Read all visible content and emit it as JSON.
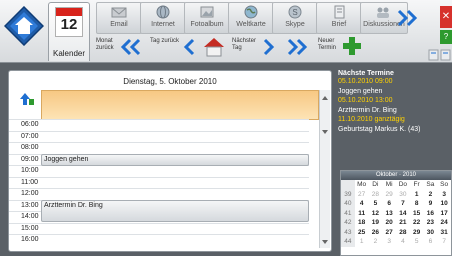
{
  "toolbar": {
    "calendar_label": "Kalender",
    "calendar_day": "12",
    "tools": [
      {
        "label": "Email",
        "icon": "email-icon"
      },
      {
        "label": "Internet",
        "icon": "globe-icon"
      },
      {
        "label": "Fotoalbum",
        "icon": "photo-album-icon"
      },
      {
        "label": "Weltkarte",
        "icon": "world-map-icon"
      },
      {
        "label": "Skype",
        "icon": "skype-icon"
      },
      {
        "label": "Brief",
        "icon": "letter-icon"
      },
      {
        "label": "Diskussionen",
        "icon": "discussions-icon"
      }
    ],
    "nav": {
      "month_back": "Monat zurück",
      "day_back": "Tag zurück",
      "next_day": "Nächster Tag",
      "new_appointment": "Neuer Termin"
    }
  },
  "day_view": {
    "title": "Dienstag, 5. Oktober 2010",
    "hours": [
      "06:00",
      "07:00",
      "08:00",
      "09:00",
      "10:00",
      "11:00",
      "12:00",
      "13:00",
      "14:00",
      "15:00",
      "16:00"
    ],
    "events": [
      {
        "label": "Joggen gehen"
      },
      {
        "label": "Arzttermin Dr. Bing"
      }
    ]
  },
  "upcoming": {
    "title": "Nächste Termine",
    "lines": [
      {
        "text": "05.10.2010 09:00",
        "color": "#ffd200"
      },
      {
        "text": "Joggen gehen",
        "color": "#ffffff"
      },
      {
        "text": "05.10.2010 13:00",
        "color": "#ffd200"
      },
      {
        "text": "Arzttermin Dr. Bing",
        "color": "#ffffff"
      },
      {
        "text": "11.10.2010 ganztägig",
        "color": "#ffd200"
      },
      {
        "text": "Geburtstag Markus K. (43)",
        "color": "#ffffff"
      }
    ]
  },
  "mini_calendar": {
    "title": "Oktober · 2010",
    "weekdays": [
      "Mo",
      "Di",
      "Mi",
      "Do",
      "Fr",
      "Sa",
      "So"
    ],
    "weeks": [
      {
        "wk": "39",
        "days": [
          "27",
          "28",
          "29",
          "30",
          "1",
          "2",
          "3"
        ]
      },
      {
        "wk": "40",
        "days": [
          "4",
          "5",
          "6",
          "7",
          "8",
          "9",
          "10"
        ]
      },
      {
        "wk": "41",
        "days": [
          "11",
          "12",
          "13",
          "14",
          "15",
          "16",
          "17"
        ]
      },
      {
        "wk": "42",
        "days": [
          "18",
          "19",
          "20",
          "21",
          "22",
          "23",
          "24"
        ]
      },
      {
        "wk": "43",
        "days": [
          "25",
          "26",
          "27",
          "28",
          "29",
          "30",
          "31"
        ]
      },
      {
        "wk": "44",
        "days": [
          "1",
          "2",
          "3",
          "4",
          "5",
          "6",
          "7"
        ]
      }
    ]
  },
  "colors": {
    "accent_blue": "#1f6fd1",
    "allday_orange": "#f7c883",
    "upcoming_date": "#ffd200",
    "close_red": "#d6312c",
    "add_green": "#2e9a2f"
  }
}
